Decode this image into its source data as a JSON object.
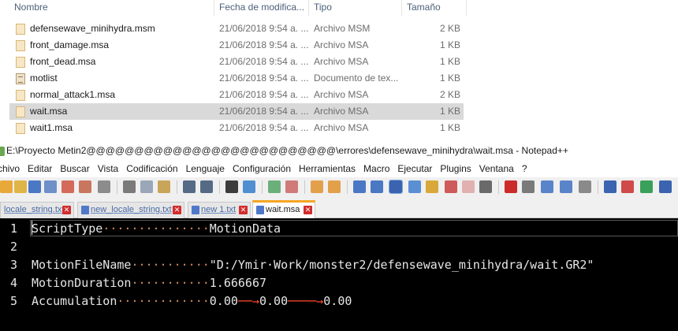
{
  "explorer": {
    "columns": {
      "name": "Nombre",
      "date": "Fecha de modifica...",
      "type": "Tipo",
      "size": "Tamaño"
    },
    "rows": [
      {
        "name": "defensewave_minihydra.msm",
        "date": "21/06/2018 9:54 a. ...",
        "type": "Archivo MSM",
        "size": "2 KB"
      },
      {
        "name": "front_damage.msa",
        "date": "21/06/2018 9:54 a. ...",
        "type": "Archivo MSA",
        "size": "1 KB"
      },
      {
        "name": "front_dead.msa",
        "date": "21/06/2018 9:54 a. ...",
        "type": "Archivo MSA",
        "size": "1 KB"
      },
      {
        "name": "motlist",
        "date": "21/06/2018 9:54 a. ...",
        "type": "Documento de tex...",
        "size": "1 KB"
      },
      {
        "name": "normal_attack1.msa",
        "date": "21/06/2018 9:54 a. ...",
        "type": "Archivo MSA",
        "size": "2 KB"
      },
      {
        "name": "wait.msa",
        "date": "21/06/2018 9:54 a. ...",
        "type": "Archivo MSA",
        "size": "1 KB"
      },
      {
        "name": "wait1.msa",
        "date": "21/06/2018 9:54 a. ...",
        "type": "Archivo MSA",
        "size": "1 KB"
      }
    ]
  },
  "notepad": {
    "title": "E:\\Proyecto Metin2@@@@@@@@@@@@@@@@@@@@@@@@@@\\errores\\defensewave_minihydra\\wait.msa - Notepad++",
    "menu": [
      "rchivo",
      "Editar",
      "Buscar",
      "Vista",
      "Codificación",
      "Lenguaje",
      "Configuración",
      "Herramientas",
      "Macro",
      "Ejecutar",
      "Plugins",
      "Ventana",
      "?"
    ],
    "tabs": [
      {
        "label": "locale_string.txt",
        "active": false
      },
      {
        "label": "new_locale_string.txt",
        "active": false
      },
      {
        "label": "new 1.txt",
        "active": false
      },
      {
        "label": "wait.msa",
        "active": true
      }
    ],
    "lines": [
      {
        "num": "1",
        "key": "ScriptType",
        "dots": "···············",
        "value": "MotionData"
      },
      {
        "num": "2",
        "key": "",
        "dots": "",
        "value": ""
      },
      {
        "num": "3",
        "key": "MotionFileName",
        "dots": "···········",
        "value": "\"D:/Ymir·Work/monster2/defensewave_minihydra/wait.GR2\""
      },
      {
        "num": "4",
        "key": "MotionDuration",
        "dots": "···········",
        "value": "1.666667"
      },
      {
        "num": "5",
        "key": "Accumulation",
        "dots": "·············",
        "value": "0.00",
        "extra": [
          "0.00",
          "0.00"
        ]
      }
    ]
  }
}
